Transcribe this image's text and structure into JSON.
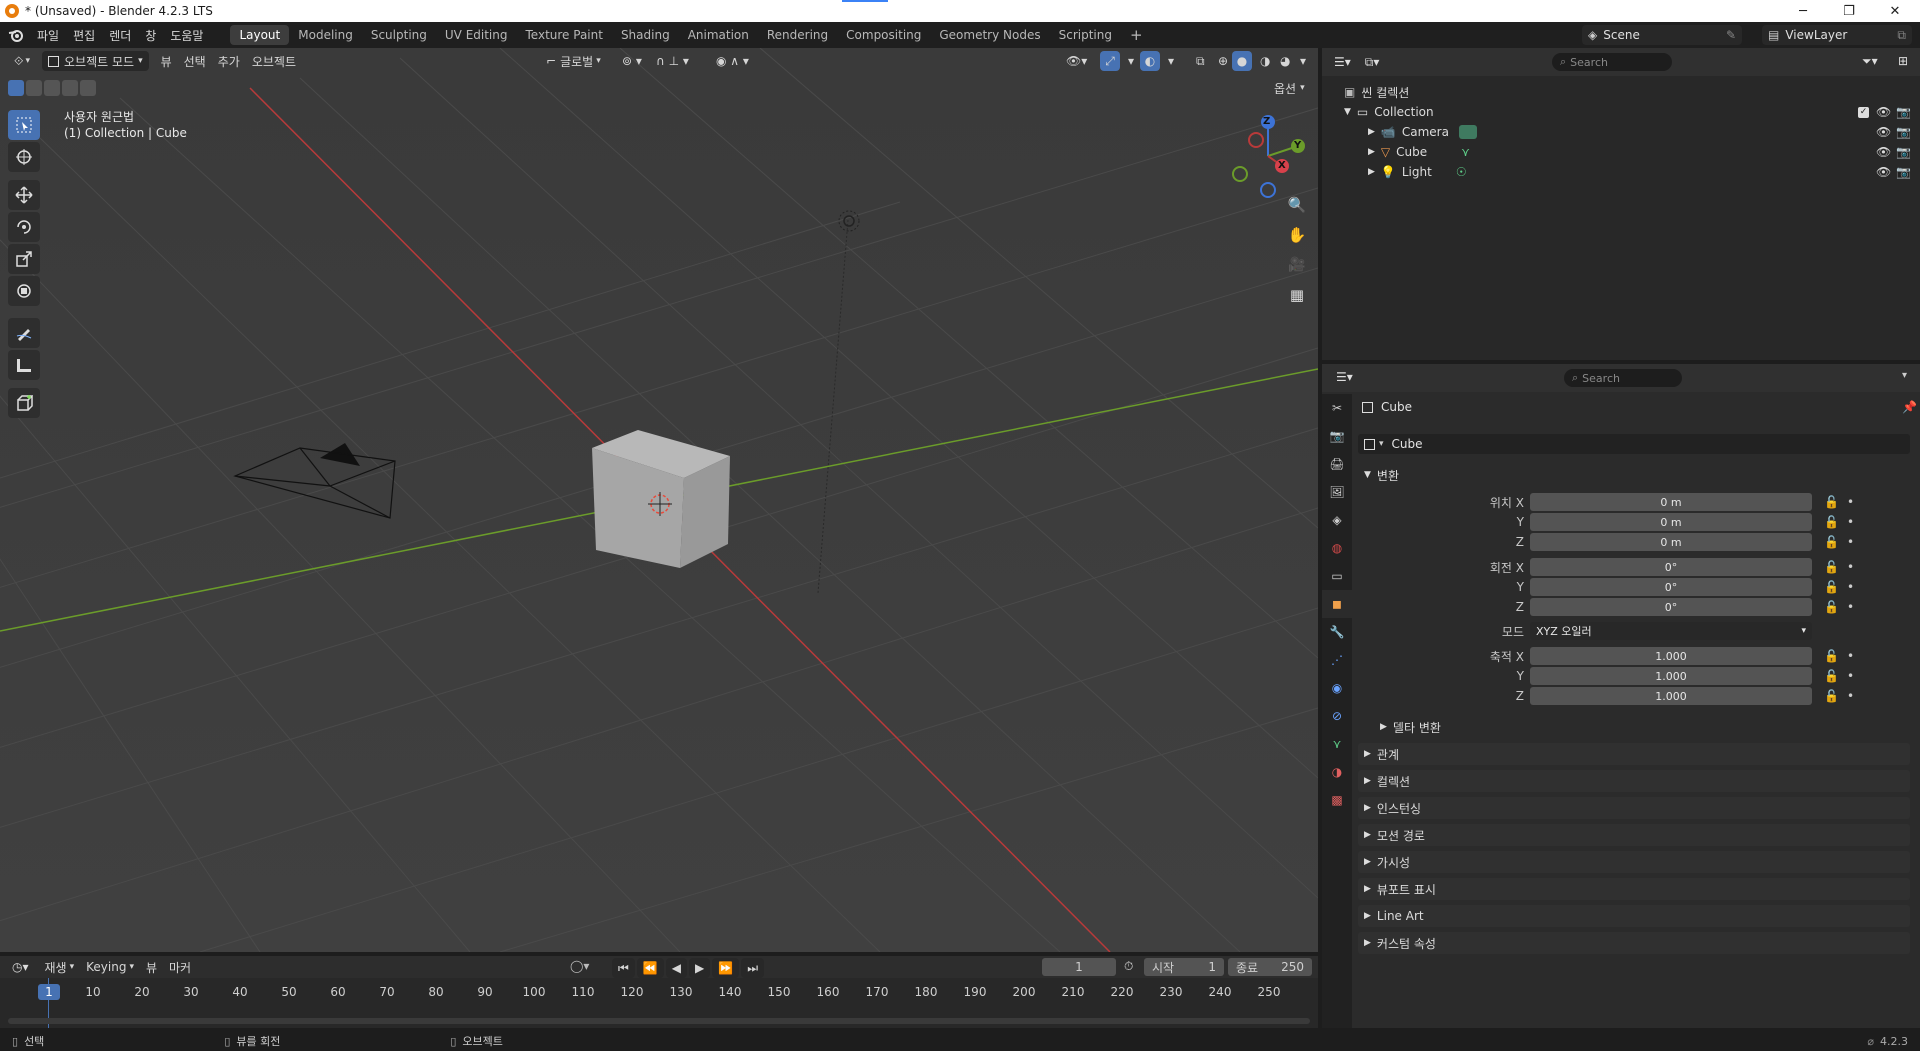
{
  "window": {
    "title": "* (Unsaved) - Blender 4.2.3 LTS",
    "controls": [
      "─",
      "❐",
      "✕"
    ]
  },
  "topbar": {
    "menus": [
      "파일",
      "편집",
      "렌더",
      "창",
      "도움말"
    ],
    "workspaces": [
      "Layout",
      "Modeling",
      "Sculpting",
      "UV Editing",
      "Texture Paint",
      "Shading",
      "Animation",
      "Rendering",
      "Compositing",
      "Geometry Nodes",
      "Scripting"
    ],
    "active_workspace": "Layout",
    "add_tab": "+",
    "scene": "Scene",
    "view_layer": "ViewLayer"
  },
  "viewport": {
    "mode": "오브젝트 모드",
    "menus": [
      "뷰",
      "선택",
      "추가",
      "오브젝트"
    ],
    "transform_orientation": "글로벌",
    "options": "옵션",
    "view_name": "사용자 원근법",
    "collection_info": "(1) Collection | Cube",
    "gizmo": {
      "z": "Z",
      "y": "Y",
      "x": "X"
    },
    "colors": {
      "x_axis": "#b83a3a",
      "y_axis": "#6b9c2a",
      "z_axis": "#3d73d6",
      "background": "#3d3d3d",
      "accent": "#4772b3"
    }
  },
  "outliner": {
    "search_placeholder": "Search",
    "root": "씬 컬렉션",
    "collection": "Collection",
    "items": [
      {
        "name": "Camera",
        "icon": "camera-icon"
      },
      {
        "name": "Cube",
        "icon": "mesh-icon"
      },
      {
        "name": "Light",
        "icon": "light-icon"
      }
    ]
  },
  "properties": {
    "search_placeholder": "Search",
    "object_name": "Cube",
    "object_field": "Cube",
    "transform_section": "변환",
    "location": {
      "label": "위치 X",
      "x": "0 m",
      "y": "0 m",
      "z": "0 m"
    },
    "rotation": {
      "label": "회전 X",
      "x": "0°",
      "y": "0°",
      "z": "0°"
    },
    "mode": {
      "label": "모드",
      "value": "XYZ 오일러"
    },
    "scale": {
      "label": "축적 X",
      "x": "1.000",
      "y": "1.000",
      "z": "1.000"
    },
    "axis_y": "Y",
    "axis_z": "Z",
    "delta_transform": "델타 변환",
    "sections": [
      "관계",
      "컬렉션",
      "인스턴싱",
      "모션 경로",
      "가시성",
      "뷰포트 표시",
      "Line Art",
      "커스텀 속성"
    ]
  },
  "timeline": {
    "menus": [
      "재생",
      "Keying",
      "뷰",
      "마커"
    ],
    "current_frame": "1",
    "start_label": "시작",
    "start": "1",
    "end_label": "종료",
    "end": "250",
    "ticks": [
      "1",
      "10",
      "20",
      "30",
      "40",
      "50",
      "60",
      "70",
      "80",
      "90",
      "100",
      "110",
      "120",
      "130",
      "140",
      "150",
      "160",
      "170",
      "180",
      "190",
      "200",
      "210",
      "220",
      "230",
      "240",
      "250"
    ]
  },
  "statusbar": {
    "select": "선택",
    "rotate_view": "뷰를 회전",
    "object": "오브젝트",
    "version": "4.2.3"
  }
}
